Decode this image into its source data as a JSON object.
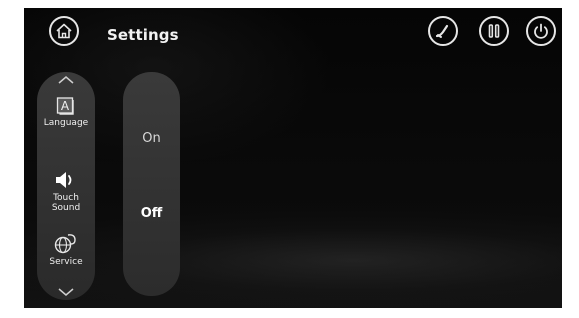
{
  "header": {
    "title": "Settings",
    "icons": [
      "home-icon",
      "recline-icon",
      "pause-icon",
      "power-icon"
    ]
  },
  "sidebar": {
    "items": [
      {
        "label": "Language",
        "icon": "language-icon"
      },
      {
        "label": "Touch\nSound",
        "icon": "speaker-icon"
      },
      {
        "label": "Service",
        "icon": "service-icon"
      }
    ],
    "scroll_up_icon": "chevron-up-icon",
    "scroll_down_icon": "chevron-down-icon"
  },
  "options": {
    "on_label": "On",
    "off_label": "Off",
    "selected": "Off"
  },
  "colors": {
    "background": "#050505",
    "panel": "#333333",
    "foreground": "#f0f0f0"
  }
}
